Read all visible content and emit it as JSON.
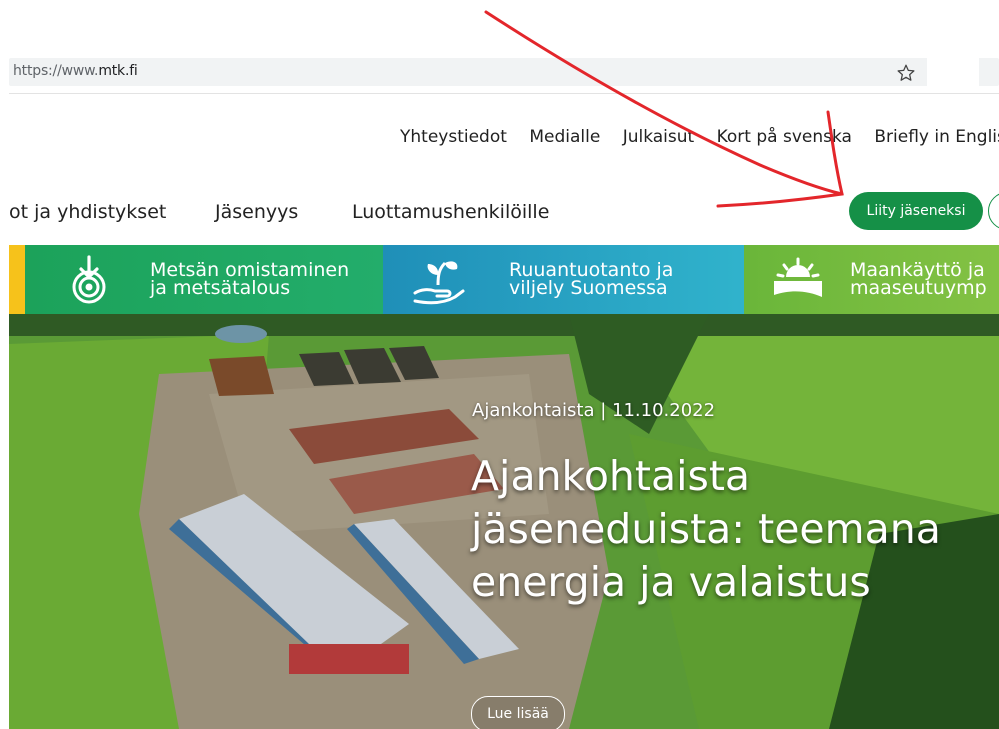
{
  "browser": {
    "url_prefix": "https://www.",
    "url_domain": "mtk.fi",
    "star_icon": "star-outline-icon"
  },
  "top_links": [
    "Yhteystiedot",
    "Medialle",
    "Julkaisut",
    "Kort på svenska",
    "Briefly in English"
  ],
  "main_nav": {
    "item1": "ot ja yhdistykset",
    "item2": "Jäsenyys",
    "item3": "Luottamushenkilöille",
    "join_label": "Liity jäseneksi"
  },
  "categories": [
    {
      "line1": "Metsän omistaminen",
      "line2": "ja metsätalous",
      "icon": "forest-rings-icon"
    },
    {
      "line1": "Ruuantuotanto ja",
      "line2": "viljely Suomessa",
      "icon": "hand-sprout-icon"
    },
    {
      "line1": "Maankäyttö ja",
      "line2": "maaseutuymp",
      "icon": "sunrise-field-icon"
    }
  ],
  "hero": {
    "meta": "Ajankohtaista | 11.10.2022",
    "title": "Ajankohtaista jäseneduista: teemana energia ja valaistus",
    "read_more": "Lue lisää"
  },
  "colors": {
    "brand_green": "#159047",
    "accent_yellow": "#f6c21b",
    "annotation_red": "#e3262b"
  }
}
